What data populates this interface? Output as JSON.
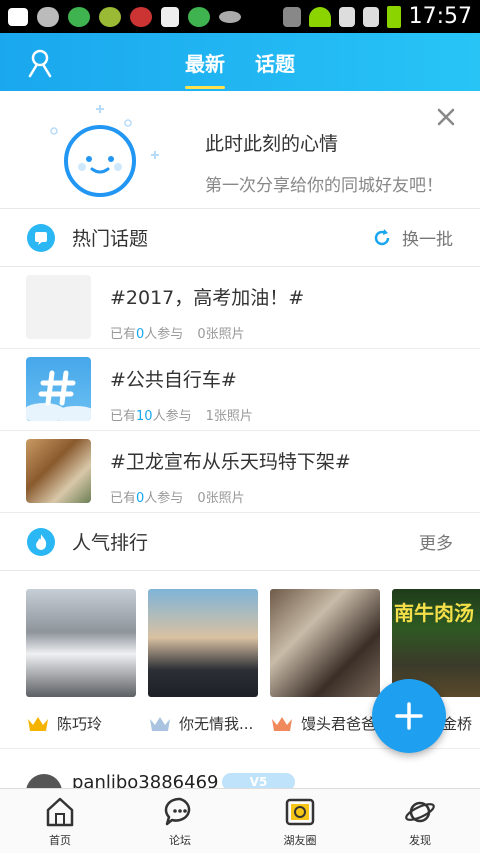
{
  "status_bar": {
    "icons": [
      "add-icon",
      "weather-icon",
      "browser-icon",
      "app-icon",
      "app-icon",
      "news-icon",
      "browser-icon",
      "eye-icon",
      "mute-icon",
      "wifi-icon",
      "sim-icon",
      "sim-icon",
      "battery-icon"
    ],
    "time": "17:57"
  },
  "header": {
    "tabs": [
      {
        "label": "最新",
        "active": true
      },
      {
        "label": "话题",
        "active": false
      }
    ]
  },
  "mood_card": {
    "title": "此时此刻的心情",
    "subtitle": "第一次分享给你的同城好友吧！"
  },
  "hot_topics": {
    "title": "热门话题",
    "refresh_label": "换一批",
    "items": [
      {
        "title": "#2017，高考加油！#",
        "meta_prefix": "已有",
        "participants": "0",
        "meta_suffix": "人参与",
        "photos": "0张照片"
      },
      {
        "title": "#公共自行车#",
        "meta_prefix": "已有",
        "participants": "10",
        "meta_suffix": "人参与",
        "photos": "1张照片"
      },
      {
        "title": "#卫龙宣布从乐天玛特下架#",
        "meta_prefix": "已有",
        "participants": "0",
        "meta_suffix": "人参与",
        "photos": "0张照片"
      }
    ]
  },
  "popularity": {
    "title": "人气排行",
    "more_label": "更多",
    "users": [
      {
        "name": "陈巧玲",
        "rank": "1"
      },
      {
        "name": "你无情我...",
        "rank": "2"
      },
      {
        "name": "馒头君爸爸",
        "rank": "3"
      },
      {
        "name": "金桥",
        "rank": "4"
      }
    ],
    "thumb_text_4": "南牛肉汤"
  },
  "feed_peek": {
    "username": "panlibo3886469",
    "badge": "V5"
  },
  "bottom_nav": [
    {
      "label": "首页",
      "icon": "home-icon"
    },
    {
      "label": "论坛",
      "icon": "forum-icon"
    },
    {
      "label": "湖友圈",
      "icon": "circle-icon"
    },
    {
      "label": "发现",
      "icon": "planet-icon"
    }
  ],
  "colors": {
    "accent": "#1aa7ee",
    "tab_underline": "#ffe14d",
    "fab": "#1e9ff0"
  }
}
